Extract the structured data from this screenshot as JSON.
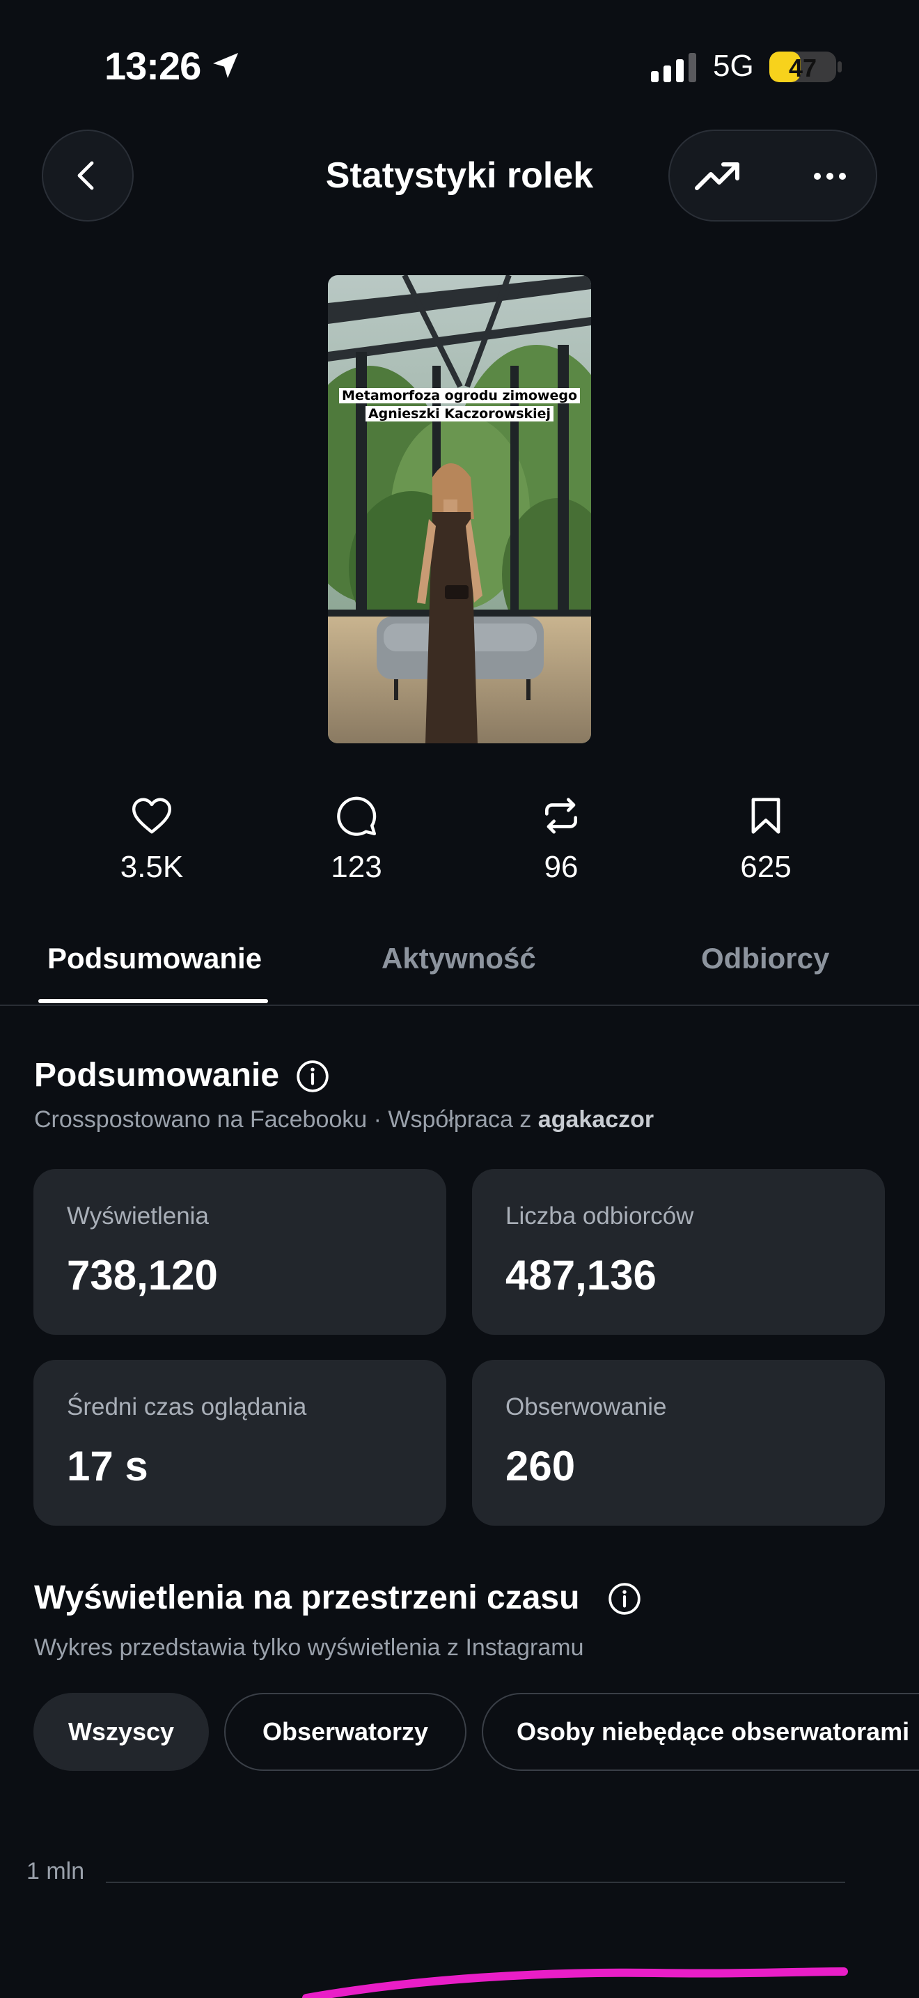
{
  "status_bar": {
    "time": "13:26",
    "network": "5G",
    "battery_percent": 47
  },
  "header": {
    "title": "Statystyki rolek"
  },
  "thumbnail": {
    "caption_line1": "Metamorfoza ogrodu zimowego",
    "caption_line2": "Agnieszki Kaczorowskiej"
  },
  "engagement": [
    {
      "icon": "heart-icon",
      "value": "3.5K"
    },
    {
      "icon": "comment-icon",
      "value": "123"
    },
    {
      "icon": "repost-icon",
      "value": "96"
    },
    {
      "icon": "bookmark-icon",
      "value": "625"
    }
  ],
  "tabs": [
    {
      "label": "Podsumowanie",
      "active": true
    },
    {
      "label": "Aktywność",
      "active": false
    },
    {
      "label": "Odbiorcy",
      "active": false
    }
  ],
  "summary": {
    "title": "Podsumowanie",
    "subtitle_prefix": "Crosspostowano na Facebooku · Współpraca z ",
    "collaborator": "agakaczor",
    "metrics": [
      {
        "label": "Wyświetlenia",
        "value": "738,120"
      },
      {
        "label": "Liczba odbiorców",
        "value": "487,136"
      },
      {
        "label": "Średni czas oglądania",
        "value": "17 s"
      },
      {
        "label": "Obserwowanie",
        "value": "260"
      }
    ]
  },
  "views_over_time": {
    "title": "Wyświetlenia na przestrzeni czasu",
    "subtitle": "Wykres przedstawia tylko wyświetlenia z Instagramu",
    "filters": [
      {
        "label": "Wszyscy",
        "active": true
      },
      {
        "label": "Obserwatorzy",
        "active": false
      },
      {
        "label": "Osoby niebędące obserwatorami",
        "active": false
      }
    ]
  },
  "chart_data": {
    "type": "line",
    "y_tick_labels": [
      "1 mln"
    ],
    "series_color": "#e91ec7"
  },
  "colors": {
    "accent": "#e91ec7",
    "battery": "#f7d21c",
    "background": "#0b0e13",
    "card": "#22262c"
  }
}
